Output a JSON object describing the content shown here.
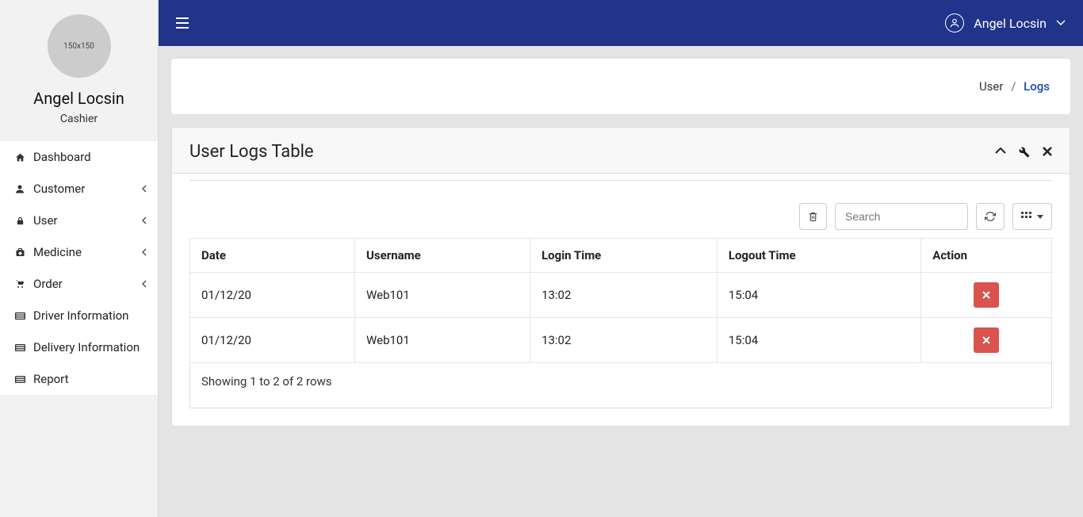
{
  "profile": {
    "avatar_placeholder": "150x150",
    "name": "Angel Locsin",
    "role": "Cashier"
  },
  "sidebar": {
    "items": [
      {
        "icon": "home-icon",
        "label": "Dashboard",
        "expandable": false
      },
      {
        "icon": "user-icon",
        "label": "Customer",
        "expandable": true
      },
      {
        "icon": "lock-icon",
        "label": "User",
        "expandable": true
      },
      {
        "icon": "medkit-icon",
        "label": "Medicine",
        "expandable": true
      },
      {
        "icon": "cart-icon",
        "label": "Order",
        "expandable": true
      },
      {
        "icon": "list-icon",
        "label": "Driver Information",
        "expandable": false
      },
      {
        "icon": "list-icon",
        "label": "Delivery Information",
        "expandable": false
      },
      {
        "icon": "list-icon",
        "label": "Report",
        "expandable": false
      }
    ]
  },
  "topbar": {
    "user_name": "Angel Locsin"
  },
  "breadcrumb": {
    "parent": "User",
    "sep": "/",
    "current": "Logs"
  },
  "panel": {
    "title": "User Logs Table",
    "search_placeholder": "Search",
    "columns": [
      "Date",
      "Username",
      "Login Time",
      "Logout Time",
      "Action"
    ],
    "rows": [
      {
        "date": "01/12/20",
        "username": "Web101",
        "login_time": "13:02",
        "logout_time": "15:04"
      },
      {
        "date": "01/12/20",
        "username": "Web101",
        "login_time": "13:02",
        "logout_time": "15:04"
      }
    ],
    "paging_info": "Showing 1 to 2 of 2 rows"
  },
  "icons": {
    "home": "home",
    "user": "user",
    "lock": "lock",
    "medkit": "medkit",
    "cart": "cart",
    "list": "list"
  }
}
